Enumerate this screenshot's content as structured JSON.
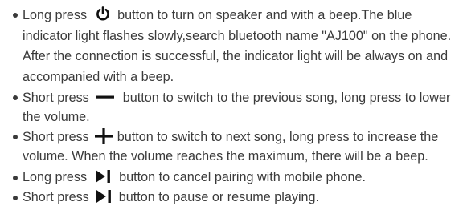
{
  "instructions": {
    "items": [
      {
        "icon": "power-icon",
        "before": "Long press",
        "after": "button to turn on speaker and with a beep.The blue indicator light flashes slowly,search bluetooth name \"AJ100\" on the phone. After the connection is successful, the indicator light will be always on and accompanied with a beep."
      },
      {
        "icon": "minus-icon",
        "before": "Short press",
        "after": "button to switch to the previous song, long press to lower the volume."
      },
      {
        "icon": "plus-icon",
        "before": "Short press",
        "after": "button to switch to next song, long press to increase the volume. When the volume reaches the maximum, there will be a beep."
      },
      {
        "icon": "play-pause-icon",
        "before": "Long press",
        "after": "button to cancel pairing with mobile phone."
      },
      {
        "icon": "play-pause-icon",
        "before": "Short press",
        "after": "button to pause or resume playing."
      }
    ]
  }
}
